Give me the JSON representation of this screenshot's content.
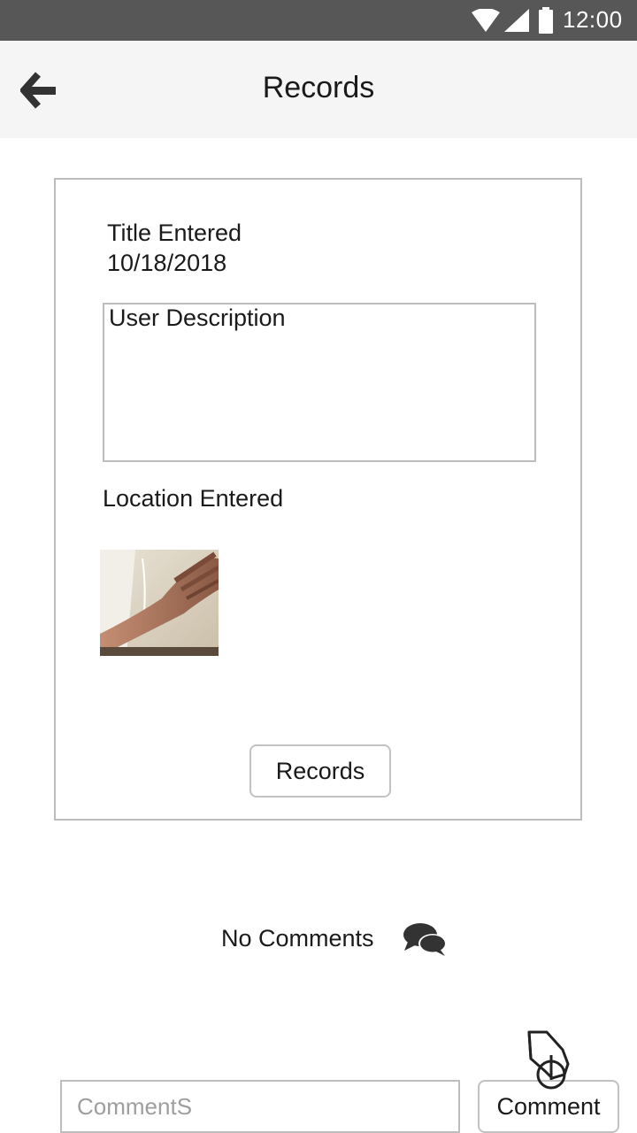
{
  "status_bar": {
    "time": "12:00",
    "icons": [
      "wifi-icon",
      "cell-signal-icon",
      "battery-icon"
    ]
  },
  "app_bar": {
    "title": "Records",
    "back_icon": "arrow-left-icon"
  },
  "record": {
    "title": "Title Entered",
    "date": "10/18/2018",
    "description": "User Description",
    "location": "Location Entered",
    "photo": "hand-photo-thumbnail",
    "records_button_label": "Records"
  },
  "comments": {
    "empty_text": "No Comments",
    "icon": "comments-icon",
    "input_placeholder": "CommentS",
    "input_value": "",
    "submit_label": "Comment",
    "tap_hint_icon": "tap-hand-icon"
  },
  "colors": {
    "status_bar": "#575757",
    "app_bar": "#f5f5f5",
    "border": "#bdbdbd",
    "icon": "#333333"
  }
}
